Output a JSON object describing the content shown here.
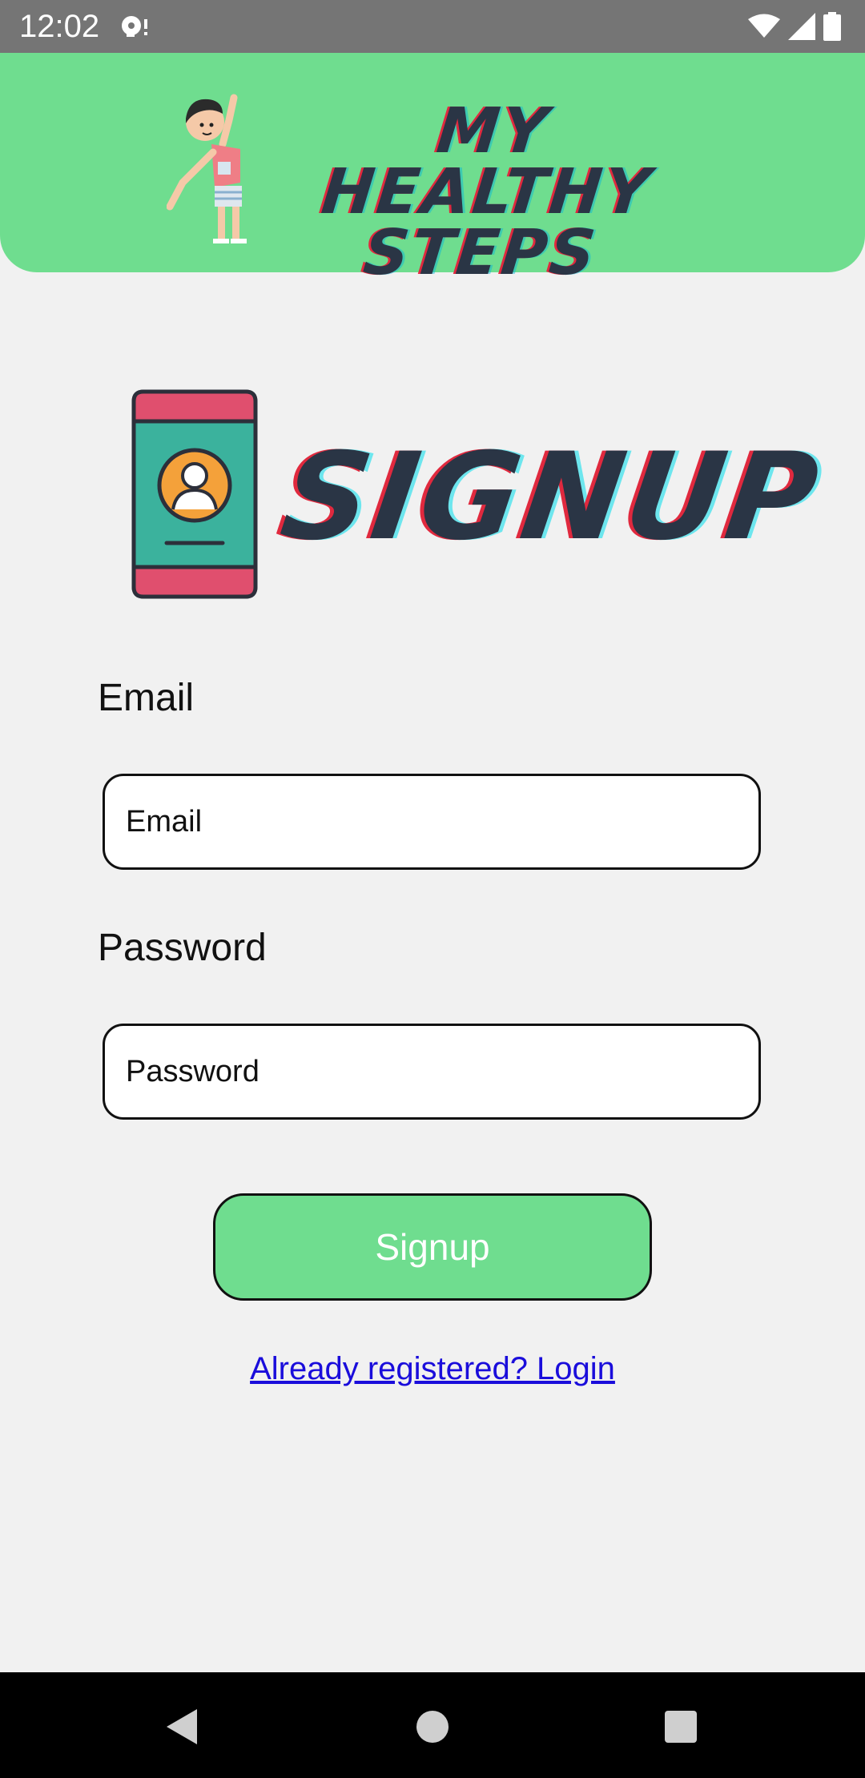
{
  "status_bar": {
    "time": "12:02"
  },
  "header": {
    "logo_text": "MY HEALTHY STEPS",
    "logo_line1": "MY HEALTHY",
    "logo_line2": "STEPS",
    "background_color": "#6fdd8f"
  },
  "banner": {
    "heading": "SIGNUP",
    "icon": "phone-profile-icon"
  },
  "form": {
    "email_label": "Email",
    "email_placeholder": "Email",
    "email_value": "",
    "password_label": "Password",
    "password_placeholder": "Password",
    "password_value": "",
    "submit_label": "Signup",
    "submit_color": "#6fdd8f"
  },
  "footer_link": {
    "text": "Already registered? Login",
    "color": "#1a0ddb"
  },
  "nav_bar": {
    "back_icon": "back-triangle-icon",
    "home_icon": "home-circle-icon",
    "recents_icon": "recents-square-icon"
  }
}
